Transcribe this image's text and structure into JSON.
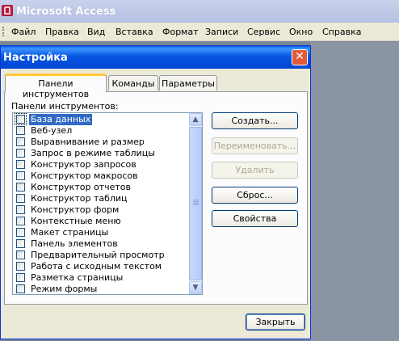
{
  "app": {
    "title": "Microsoft Access"
  },
  "menu": [
    "Файл",
    "Правка",
    "Вид",
    "Вставка",
    "Формат",
    "Записи",
    "Сервис",
    "Окно",
    "Справка"
  ],
  "dialog": {
    "title": "Настройка",
    "tabs": [
      "Панели инструментов",
      "Команды",
      "Параметры"
    ],
    "active_tab": "Панели инструментов",
    "list_label": "Панели инструментов:",
    "items": [
      "База данных",
      "Веб-узел",
      "Выравнивание и размер",
      "Запрос в режиме таблицы",
      "Конструктор запросов",
      "Конструктор макросов",
      "Конструктор отчетов",
      "Конструктор таблиц",
      "Конструктор форм",
      "Контекстные меню",
      "Макет страницы",
      "Панель элементов",
      "Предварительный просмотр",
      "Работа с исходным текстом",
      "Разметка страницы",
      "Режим формы"
    ],
    "selected_item": "База данных",
    "buttons": {
      "create": "Создать...",
      "rename": "Переименовать...",
      "delete": "Удалить",
      "reset": "Сброс...",
      "properties": "Свойства",
      "close": "Закрыть"
    }
  }
}
